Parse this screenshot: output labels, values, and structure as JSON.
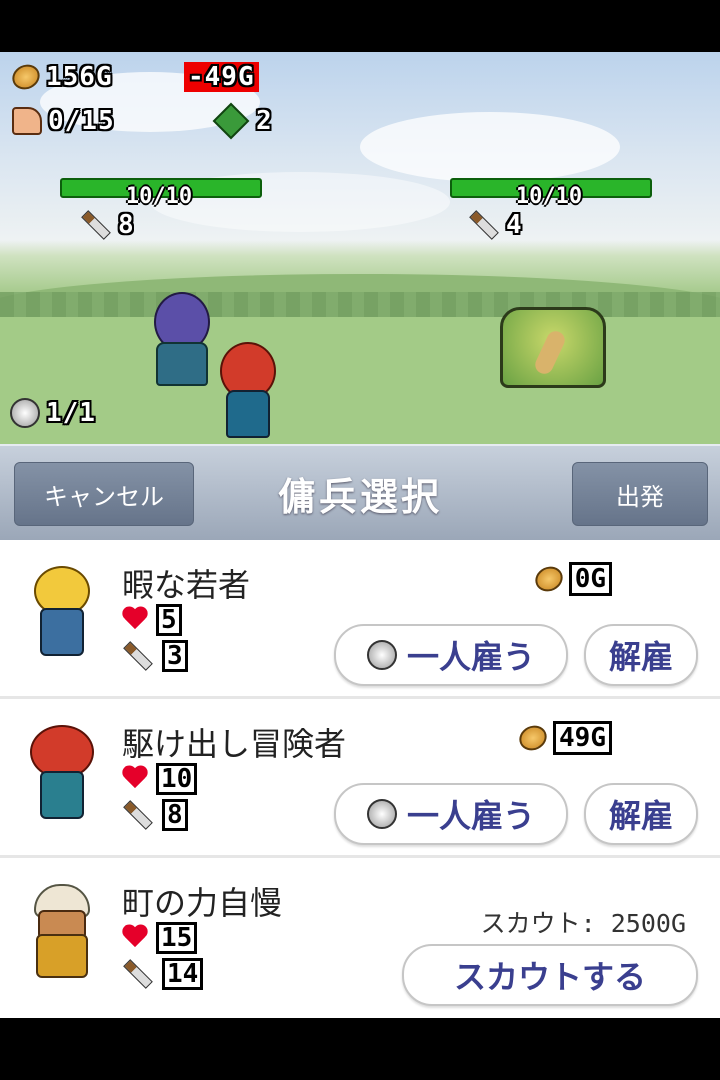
{
  "hud": {
    "gold": "156G",
    "gold_change": "-49G",
    "party_capacity": "0/15",
    "gems": "2",
    "units": "1/1"
  },
  "battle": {
    "ally_hp": "10/10",
    "ally_attack": "8",
    "enemy_hp": "10/10",
    "enemy_attack": "4"
  },
  "header": {
    "cancel_label": "キャンセル",
    "title": "傭兵選択",
    "depart_label": "出発"
  },
  "mercenaries": [
    {
      "name": "暇な若者",
      "cost": "0G",
      "hp": "5",
      "attack": "3",
      "hire_label": "一人雇う",
      "fire_label": "解雇"
    },
    {
      "name": "駆け出し冒険者",
      "cost": "49G",
      "hp": "10",
      "attack": "8",
      "hire_label": "一人雇う",
      "fire_label": "解雇"
    },
    {
      "name": "町の力自慢",
      "hp": "15",
      "attack": "14",
      "scout_cost": "スカウト: 2500G",
      "scout_label": "スカウトする"
    }
  ],
  "icons": [
    "coin-icon",
    "muscle-arm-icon",
    "green-gem-icon",
    "knight-helmet-icon",
    "sword-icon",
    "heart-icon"
  ]
}
